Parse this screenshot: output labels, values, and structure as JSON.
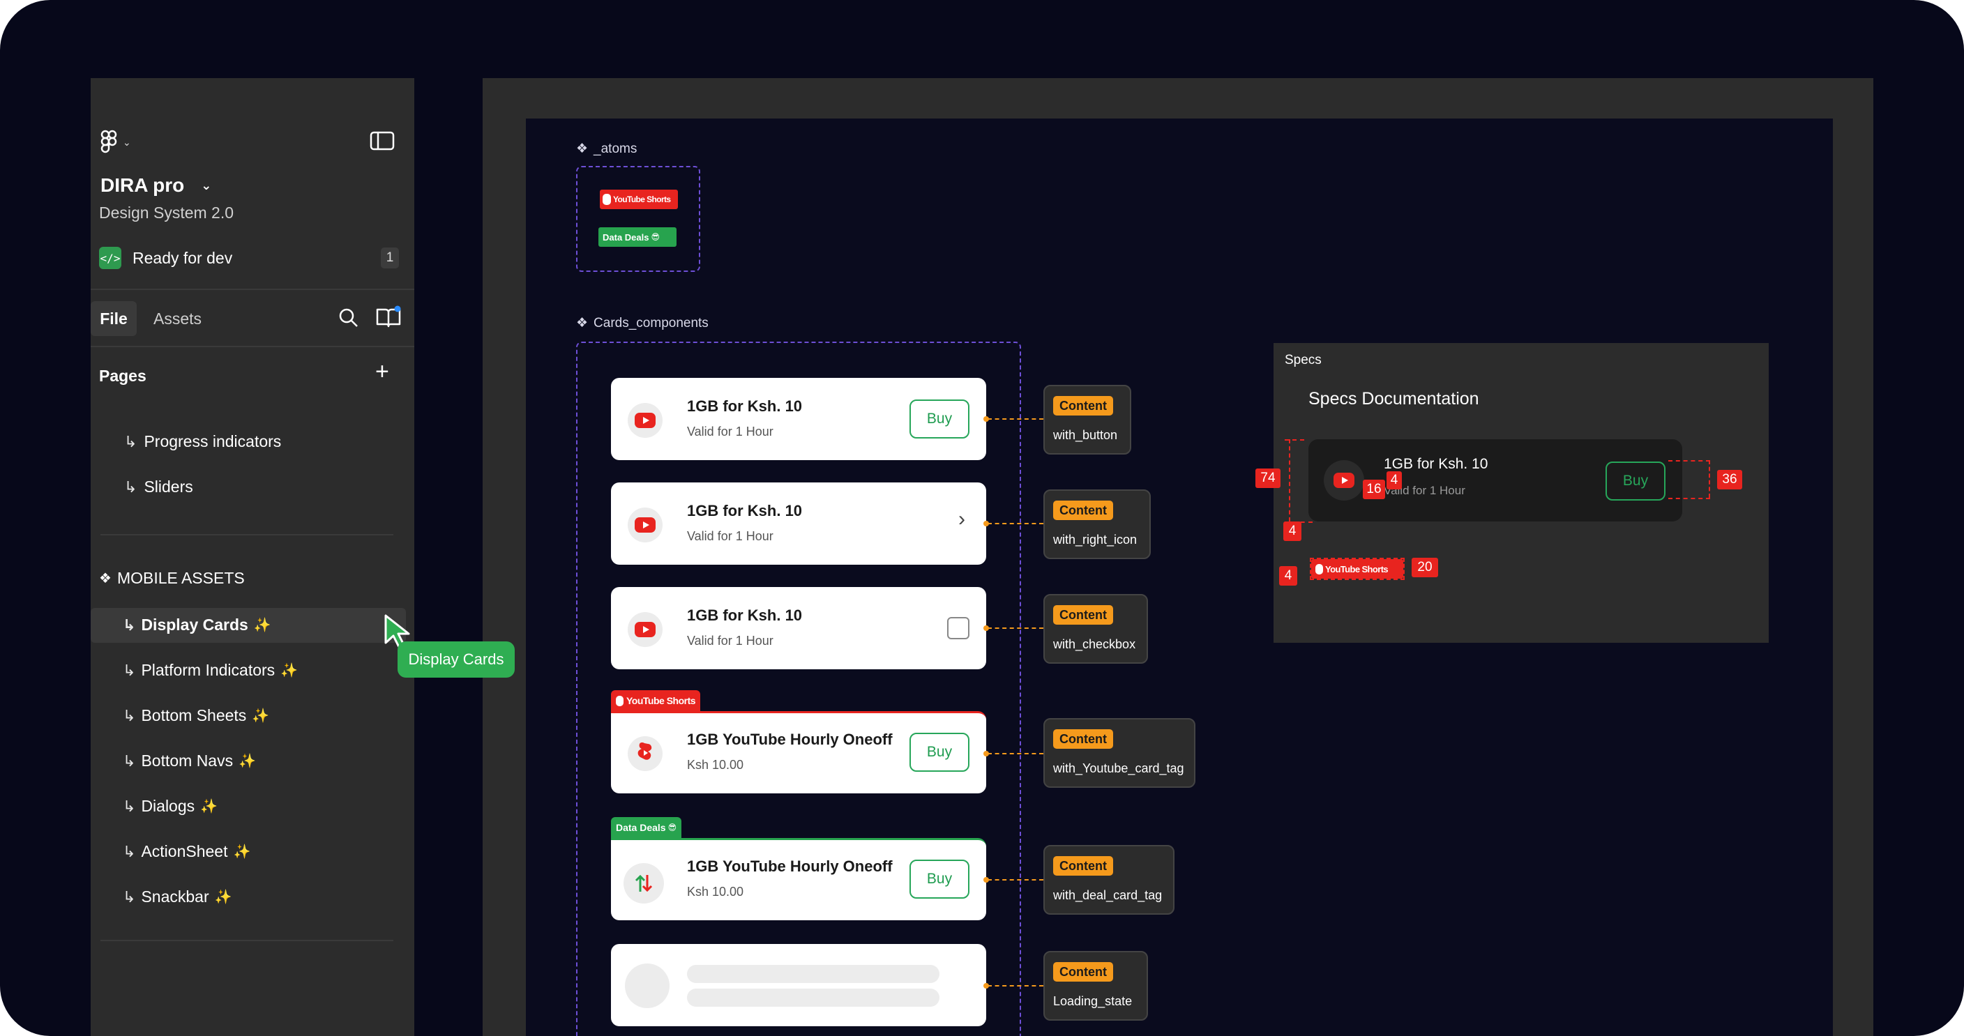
{
  "sidebar": {
    "project_name": "DIRA pro",
    "project_subtitle": "Design System 2.0",
    "ready_for_dev": {
      "label": "Ready for dev",
      "count": "1"
    },
    "tabs": [
      {
        "label": "File"
      },
      {
        "label": "Assets"
      }
    ],
    "pages_title": "Pages",
    "pages": [
      {
        "label": "Progress indicators"
      },
      {
        "label": "Sliders"
      }
    ],
    "assets_section_title": "MOBILE ASSETS",
    "assets": [
      {
        "label": "Display Cards",
        "spark": "✨"
      },
      {
        "label": "Platform Indicators",
        "spark": "✨"
      },
      {
        "label": "Bottom Sheets",
        "spark": "✨"
      },
      {
        "label": "Bottom Navs",
        "spark": "✨"
      },
      {
        "label": "Dialogs",
        "spark": "✨"
      },
      {
        "label": "ActionSheet",
        "spark": "✨"
      },
      {
        "label": "Snackbar",
        "spark": "✨"
      }
    ],
    "tooltip": "Display Cards"
  },
  "canvas": {
    "atoms_label": "_atoms",
    "atoms": {
      "youtube_tag": "YouTube Shorts",
      "data_deals_tag": "Data Deals",
      "emoji": "😎"
    },
    "cards_label": "Cards_components",
    "cards": [
      {
        "title": "1GB for Ksh. 10",
        "subtitle": "Valid for 1 Hour",
        "action": "Buy"
      },
      {
        "title": "1GB for Ksh. 10",
        "subtitle": "Valid for 1 Hour",
        "action": "›"
      },
      {
        "title": "1GB for Ksh. 10",
        "subtitle": "Valid for 1 Hour"
      },
      {
        "title": "1GB YouTube Hourly Oneoff",
        "subtitle": "Ksh 10.00",
        "action": "Buy",
        "tag": "YouTube Shorts"
      },
      {
        "title": "1GB YouTube Hourly Oneoff",
        "subtitle": "Ksh 10.00",
        "action": "Buy",
        "tag": "Data Deals"
      },
      {
        "title": "",
        "subtitle": ""
      }
    ],
    "variants": [
      {
        "badge": "Content",
        "label": "with_button"
      },
      {
        "badge": "Content",
        "label": "with_right_icon"
      },
      {
        "badge": "Content",
        "label": "with_checkbox"
      },
      {
        "badge": "Content",
        "label": "with_Youtube_card_tag"
      },
      {
        "badge": "Content",
        "label": "with_deal_card_tag"
      },
      {
        "badge": "Content",
        "label": "Loading_state"
      }
    ],
    "specs": {
      "frame_label": "Specs",
      "title": "Specs Documentation",
      "card_title": "1GB for Ksh. 10",
      "card_subtitle": "Valid for 1 Hour",
      "card_action": "Buy",
      "measurements": {
        "height": "74",
        "icon": "16",
        "gap": "4",
        "button_height": "36",
        "padding_bottom": "4",
        "tag_left": "4",
        "tag_height": "20"
      },
      "tag_text": "YouTube Shorts"
    }
  },
  "colors": {
    "accent_orange": "#f59a1c",
    "brand_red": "#e8241f",
    "brand_green": "#27a65a",
    "selection_purple": "#6d4fd6"
  }
}
